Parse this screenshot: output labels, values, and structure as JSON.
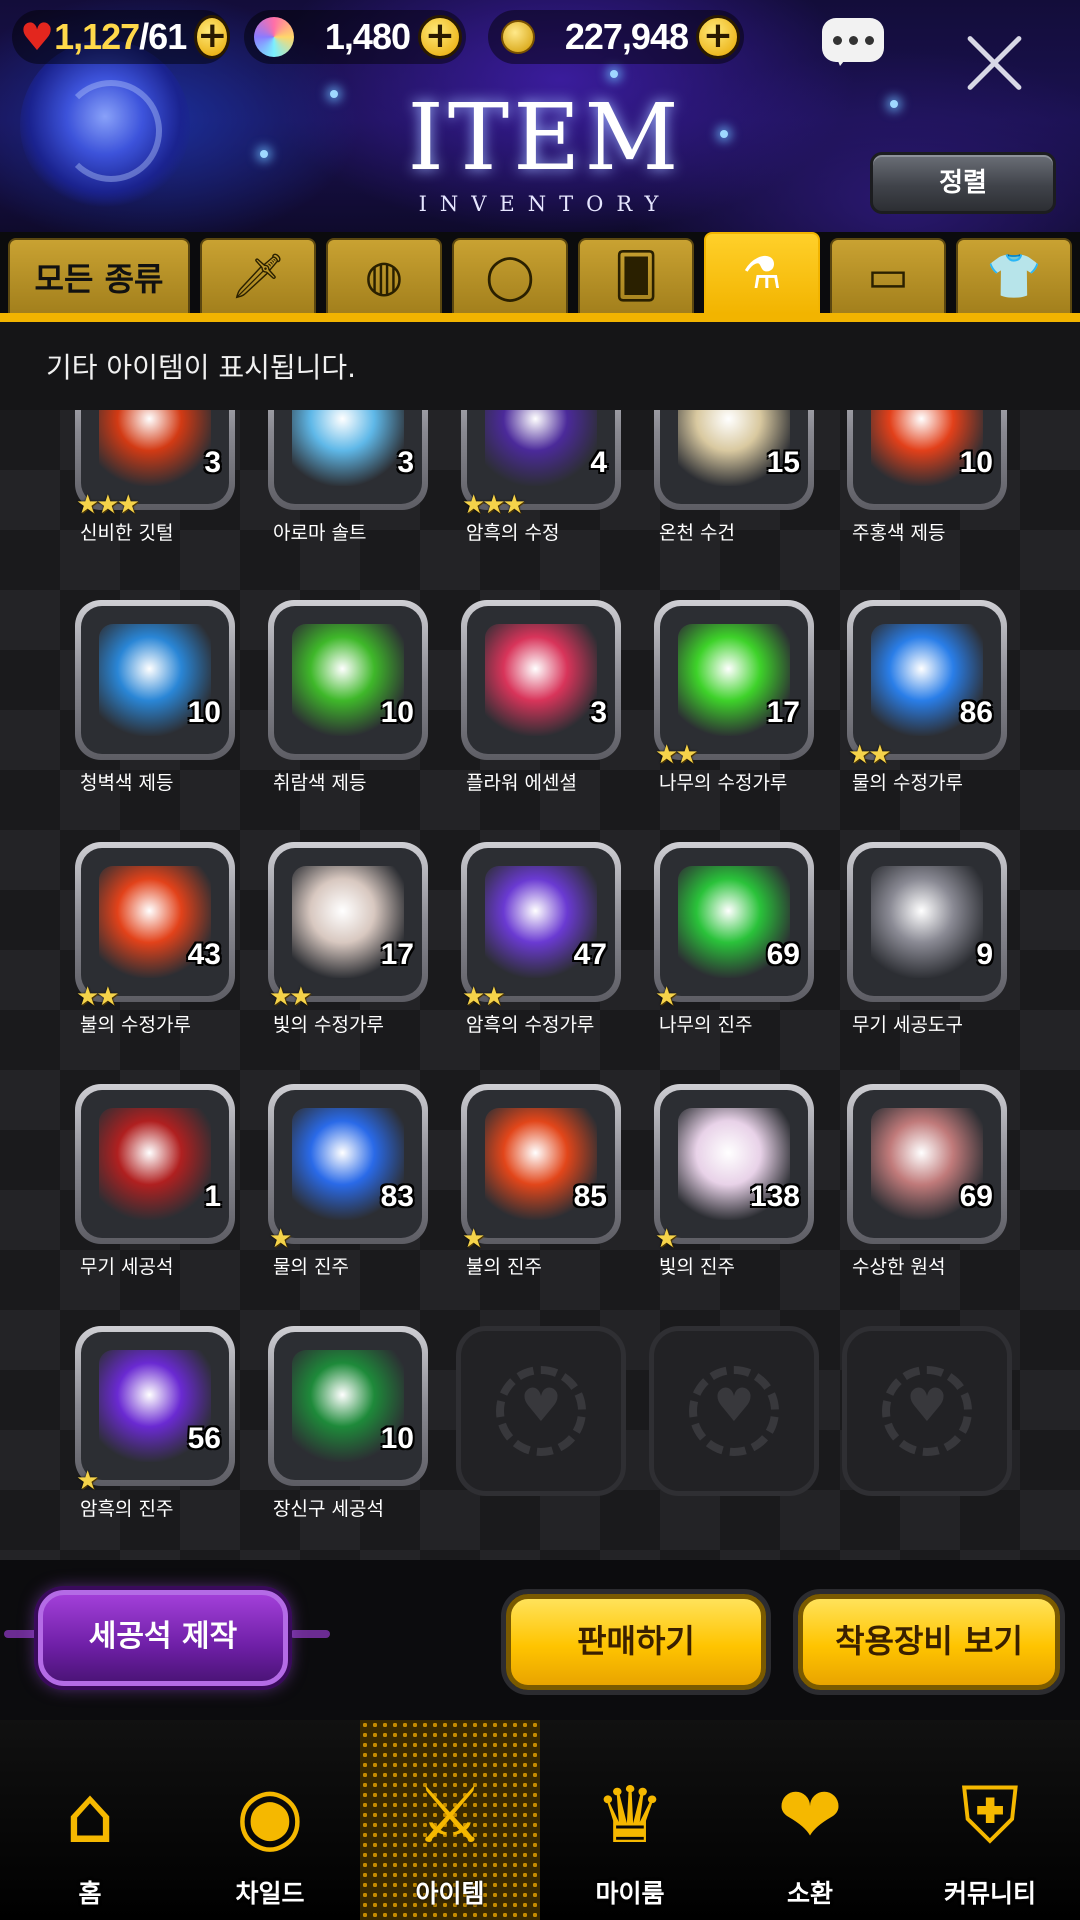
{
  "resources": {
    "hearts": {
      "current": "1,127",
      "max": "/61",
      "icon": "heart-icon"
    },
    "gems": {
      "value": "1,480",
      "icon": "gem-icon"
    },
    "gold": {
      "value": "227,948",
      "icon": "coin-icon"
    }
  },
  "header": {
    "title": "ITEM",
    "subtitle": "INVENTORY",
    "sort_label": "정렬"
  },
  "tabs": [
    {
      "label": "모든 종류",
      "icon": "all-types"
    },
    {
      "icon": "sword-icon"
    },
    {
      "icon": "shield-icon"
    },
    {
      "icon": "ring-icon"
    },
    {
      "icon": "card-icon"
    },
    {
      "icon": "flask-icon",
      "active": true
    },
    {
      "icon": "frame-icon"
    },
    {
      "icon": "shirt-icon"
    }
  ],
  "notice": "기타 아이템이 표시됩니다.",
  "items": [
    {
      "name": "신비한 깃털",
      "qty": "3",
      "stars": 3,
      "color": "#d23a14"
    },
    {
      "name": "아로마 솔트",
      "qty": "3",
      "stars": 0,
      "color": "#5fb8e8"
    },
    {
      "name": "암흑의 수정",
      "qty": "4",
      "stars": 3,
      "color": "#4b2a9a"
    },
    {
      "name": "온천 수건",
      "qty": "15",
      "stars": 0,
      "color": "#d9c9a0"
    },
    {
      "name": "주홍색 제등",
      "qty": "10",
      "stars": 0,
      "color": "#e2401a"
    },
    {
      "name": "청벽색 제등",
      "qty": "10",
      "stars": 0,
      "color": "#2a86d6"
    },
    {
      "name": "취람색 제등",
      "qty": "10",
      "stars": 0,
      "color": "#3fb82a"
    },
    {
      "name": "플라워 에센셜",
      "qty": "3",
      "stars": 0,
      "color": "#d8345a"
    },
    {
      "name": "나무의 수정가루",
      "qty": "17",
      "stars": 2,
      "color": "#3ed22a"
    },
    {
      "name": "물의 수정가루",
      "qty": "86",
      "stars": 2,
      "color": "#2a7ee8"
    },
    {
      "name": "불의 수정가루",
      "qty": "43",
      "stars": 2,
      "color": "#e2421a"
    },
    {
      "name": "빛의 수정가루",
      "qty": "17",
      "stars": 2,
      "color": "#d8c8c0"
    },
    {
      "name": "암흑의 수정가루",
      "qty": "47",
      "stars": 2,
      "color": "#6a3ad2"
    },
    {
      "name": "나무의 진주",
      "qty": "69",
      "stars": 1,
      "color": "#2ac23a"
    },
    {
      "name": "무기 세공도구",
      "qty": "9",
      "stars": 0,
      "color": "#8a8a94"
    },
    {
      "name": "무기 세공석",
      "qty": "1",
      "stars": 0,
      "color": "#b02020"
    },
    {
      "name": "물의 진주",
      "qty": "83",
      "stars": 1,
      "color": "#2a6ae8"
    },
    {
      "name": "불의 진주",
      "qty": "85",
      "stars": 1,
      "color": "#e2461a"
    },
    {
      "name": "빛의 진주",
      "qty": "138",
      "stars": 1,
      "color": "#e8d2e8"
    },
    {
      "name": "수상한 원석",
      "qty": "69",
      "stars": 0,
      "color": "#c07a7a"
    },
    {
      "name": "암흑의 진주",
      "qty": "56",
      "stars": 1,
      "color": "#6a2ad2"
    },
    {
      "name": "장신구 세공석",
      "qty": "10",
      "stars": 0,
      "color": "#1e8a3a"
    }
  ],
  "empty_slots": 3,
  "actions": {
    "craft": "세공석 제작",
    "sell": "판매하기",
    "equipped": "착용장비 보기"
  },
  "nav": [
    {
      "label": "홈",
      "icon": "home-arch-icon"
    },
    {
      "label": "차일드",
      "icon": "flame-eye-icon"
    },
    {
      "label": "아이템",
      "icon": "sword-shield-icon",
      "active": true
    },
    {
      "label": "마이룸",
      "icon": "crown-laurel-icon"
    },
    {
      "label": "소환",
      "icon": "heart-bottle-icon"
    },
    {
      "label": "커뮤니티",
      "icon": "crest-shield-icon"
    }
  ],
  "colors": {
    "accent_gold": "#f2b400",
    "craft_purple": "#7a22b4",
    "background": "#1a1a1c"
  }
}
